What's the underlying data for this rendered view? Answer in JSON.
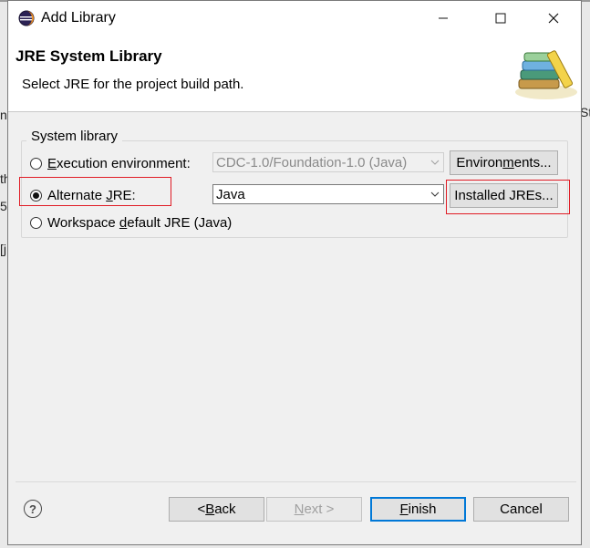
{
  "window": {
    "title": "Add Library"
  },
  "header": {
    "title": "JRE System Library",
    "description": "Select JRE for the project build path."
  },
  "group": {
    "label": "System library",
    "options": [
      {
        "pre": "",
        "mnemonic": "E",
        "post": "xecution environment:",
        "checked": false
      },
      {
        "pre": "Alternate ",
        "mnemonic": "J",
        "post": "RE:",
        "checked": true
      },
      {
        "pre": "Workspace ",
        "mnemonic": "d",
        "post": "efault JRE (Java)",
        "checked": false
      }
    ],
    "execution_env_value": "CDC-1.0/Foundation-1.0 (Java)",
    "alternate_jre_value": "Java",
    "environments_button": {
      "pre": "Environ",
      "mnemonic": "m",
      "post": "ents..."
    },
    "installed_jres_button": {
      "pre": "Installed JREs...",
      "mnemonic": "",
      "post": ""
    }
  },
  "footer": {
    "back_pre": "< ",
    "back_mnemonic": "B",
    "back_post": "ack",
    "next_mnemonic": "N",
    "next_post": "ext >",
    "finish_mnemonic": "F",
    "finish_post": "inish",
    "cancel_label": "Cancel",
    "help_glyph": "?"
  },
  "background": {
    "frag1": "ng",
    "frag2": "St",
    "frag3": "th",
    "frag4": "5",
    "frag5": "[j"
  },
  "colors": {
    "highlight": "#e01b24",
    "default_button_border": "#0078d7"
  },
  "icons": [
    "eclipse-app-icon",
    "minimize-icon",
    "maximize-icon",
    "close-icon",
    "books-library-icon",
    "help-icon",
    "chevron-down-icon"
  ]
}
